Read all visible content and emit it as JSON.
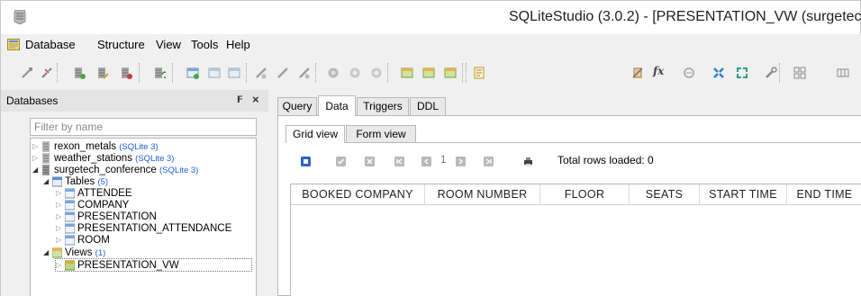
{
  "window": {
    "title": "SQLiteStudio (3.0.2) - [PRESENTATION_VW (surgetec"
  },
  "menu": {
    "items": [
      "Database",
      "Structure",
      "View",
      "Tools",
      "Help"
    ]
  },
  "toolbar": {
    "icons": [
      "connect-icon",
      "disconnect-icon",
      "add-database-icon",
      "edit-database-icon",
      "remove-database-icon",
      "refresh-icon",
      "create-table-icon",
      "edit-table-icon",
      "delete-table-icon",
      "create-index-icon",
      "edit-index-icon",
      "delete-index-icon",
      "create-trigger-icon",
      "edit-trigger-icon",
      "delete-trigger-icon",
      "create-view-icon",
      "edit-view-icon",
      "delete-view-icon",
      "sql-editor-icon",
      "ddl-history-icon",
      "functions-icon",
      "collations-icon",
      "extensions-icon",
      "tile-icon",
      "settings-icon",
      "tile-windows-icon",
      "cascade-icon"
    ],
    "fx_label": "fx"
  },
  "databases_panel": {
    "title": "Databases",
    "filter_placeholder": "Filter by name",
    "tree": [
      {
        "label": "rexon_metals",
        "tag": "(SQLite 3)"
      },
      {
        "label": "weather_stations",
        "tag": "(SQLite 3)"
      },
      {
        "label": "surgetech_conference",
        "tag": "(SQLite 3)"
      },
      {
        "label": "Tables",
        "tag": "(5)"
      },
      {
        "label": "ATTENDEE"
      },
      {
        "label": "COMPANY"
      },
      {
        "label": "PRESENTATION"
      },
      {
        "label": "PRESENTATION_ATTENDANCE"
      },
      {
        "label": "ROOM"
      },
      {
        "label": "Views",
        "tag": "(1)"
      },
      {
        "label": "PRESENTATION_VW"
      }
    ]
  },
  "editor": {
    "tabs": [
      "Query",
      "Data",
      "Triggers",
      "DDL"
    ],
    "active_tab": "Data",
    "subtabs": [
      "Grid view",
      "Form view"
    ],
    "active_subtab": "Grid view",
    "page_number": "1",
    "rows_loaded": "Total rows loaded: 0",
    "columns": [
      "BOOKED COMPANY",
      "ROOM NUMBER",
      "FLOOR",
      "SEATS",
      "START TIME",
      "END TIME"
    ]
  },
  "colors": {
    "accent_blue": "#1a5fd8",
    "panel_bg": "#f0f0f0",
    "border": "#b8b8b8"
  }
}
